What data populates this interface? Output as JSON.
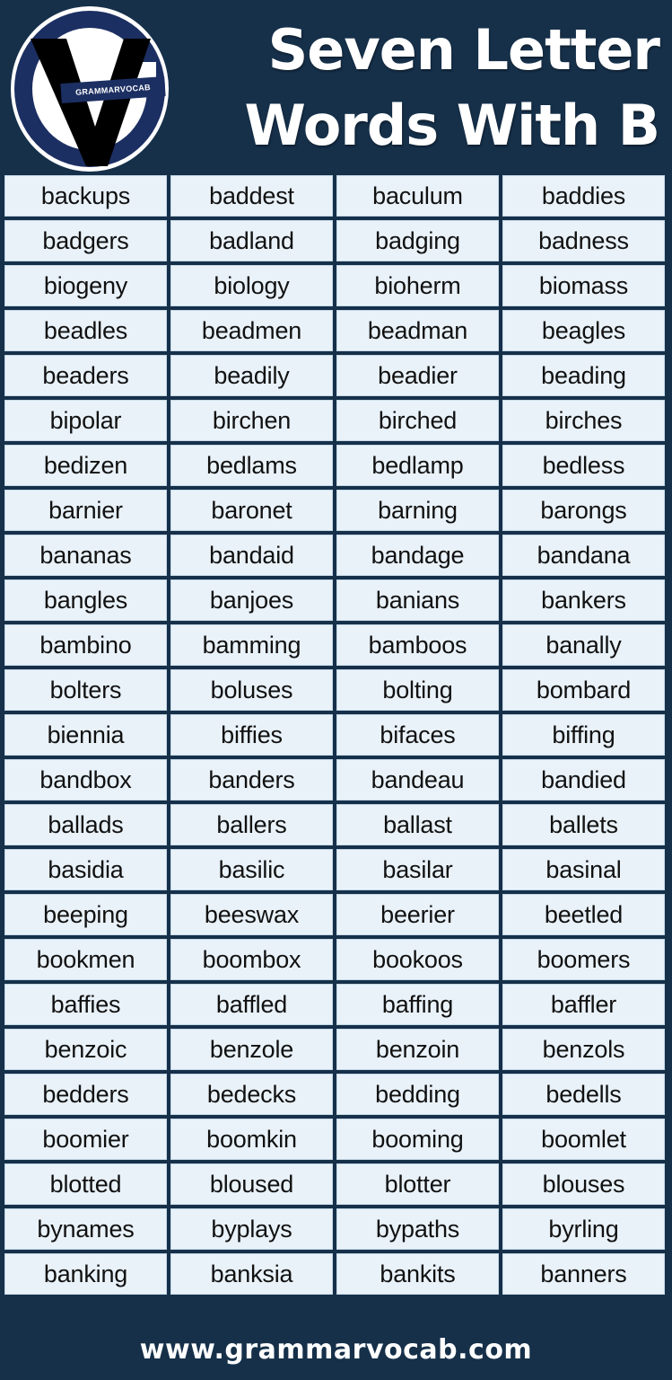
{
  "header": {
    "title_line1": "Seven Letter",
    "title_line2": "Words With B",
    "logo": {
      "brand_text": "GRAMMARVOCAB",
      "mark_letter": "V",
      "ring_color": "#1c2f62",
      "mark_color": "#000000",
      "background_color": "#ffffff"
    },
    "background_color": "#16304a"
  },
  "grid": {
    "columns": 4,
    "rows": 25,
    "cell_background": "#e9f2f9",
    "cell_text_color": "#111111",
    "words": [
      [
        "backups",
        "baddest",
        "baculum",
        "baddies"
      ],
      [
        "badgers",
        "badland",
        "badging",
        "badness"
      ],
      [
        "biogeny",
        "biology",
        "bioherm",
        "biomass"
      ],
      [
        "beadles",
        "beadmen",
        "beadman",
        "beagles"
      ],
      [
        "beaders",
        "beadily",
        "beadier",
        "beading"
      ],
      [
        "bipolar",
        "birchen",
        "birched",
        "birches"
      ],
      [
        "bedizen",
        "bedlams",
        "bedlamp",
        "bedless"
      ],
      [
        "barnier",
        "baronet",
        "barning",
        "barongs"
      ],
      [
        "bananas",
        "bandaid",
        "bandage",
        "bandana"
      ],
      [
        "bangles",
        "banjoes",
        "banians",
        "bankers"
      ],
      [
        "bambino",
        "bamming",
        "bamboos",
        "banally"
      ],
      [
        "bolters",
        "boluses",
        "bolting",
        "bombard"
      ],
      [
        "biennia",
        "biffies",
        "bifaces",
        "biffing"
      ],
      [
        "bandbox",
        "banders",
        "bandeau",
        "bandied"
      ],
      [
        "ballads",
        "ballers",
        "ballast",
        "ballets"
      ],
      [
        "basidia",
        "basilic",
        "basilar",
        "basinal"
      ],
      [
        "beeping",
        "beeswax",
        "beerier",
        "beetled"
      ],
      [
        "bookmen",
        "boombox",
        "bookoos",
        "boomers"
      ],
      [
        "baffies",
        "baffled",
        "baffing",
        "baffler"
      ],
      [
        "benzoic",
        "benzole",
        "benzoin",
        "benzols"
      ],
      [
        "bedders",
        "bedecks",
        "bedding",
        "bedells"
      ],
      [
        "boomier",
        "boomkin",
        "booming",
        "boomlet"
      ],
      [
        "blotted",
        "bloused",
        "blotter",
        "blouses"
      ],
      [
        "bynames",
        "byplays",
        "bypaths",
        "byrling"
      ],
      [
        "banking",
        "banksia",
        "bankits",
        "banners"
      ]
    ]
  },
  "footer": {
    "website": "www.grammarvocab.com",
    "background_color": "#16304a",
    "text_color": "#ffffff"
  }
}
